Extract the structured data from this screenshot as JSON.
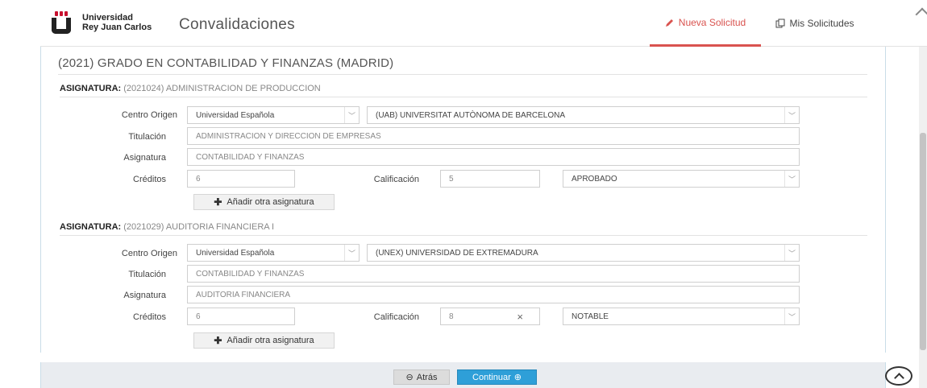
{
  "header": {
    "university_line1": "Universidad",
    "university_line2": "Rey Juan Carlos",
    "app_title": "Convalidaciones",
    "nav_new": "Nueva Solicitud",
    "nav_mine": "Mis Solicitudes",
    "accent_color": "#d9534f"
  },
  "degree": "(2021) GRADO EN CONTABILIDAD Y FINANZAS (MADRID)",
  "labels": {
    "asignatura_prefix": "ASIGNATURA:",
    "centro_origen": "Centro Origen",
    "titulacion": "Titulación",
    "asignatura": "Asignatura",
    "creditos": "Créditos",
    "calificacion": "Calificación",
    "add_button": "Añadir otra asignatura"
  },
  "blocks": [
    {
      "asignatura_code": "(2021024) ADMINISTRACION DE PRODUCCION",
      "centro_tipo": "Universidad Española",
      "universidad": "(UAB) UNIVERSITAT AUTÒNOMA DE BARCELONA",
      "titulacion": "ADMINISTRACION Y DIRECCION DE EMPRESAS",
      "asignatura": "CONTABILIDAD Y FINANZAS",
      "creditos": "6",
      "calificacion": "5",
      "nota": "APROBADO"
    },
    {
      "asignatura_code": "(2021029) AUDITORIA FINANCIERA I",
      "centro_tipo": "Universidad Española",
      "universidad": "(UNEX) UNIVERSIDAD DE EXTREMADURA",
      "titulacion": "CONTABILIDAD Y FINANZAS",
      "asignatura": "AUDITORIA FINANCIERA",
      "creditos": "6",
      "calificacion": "8",
      "nota": "NOTABLE"
    }
  ],
  "footer": {
    "back_label": "Atrás",
    "continue_label": "Continuar",
    "primary_color": "#2e9fd8"
  }
}
